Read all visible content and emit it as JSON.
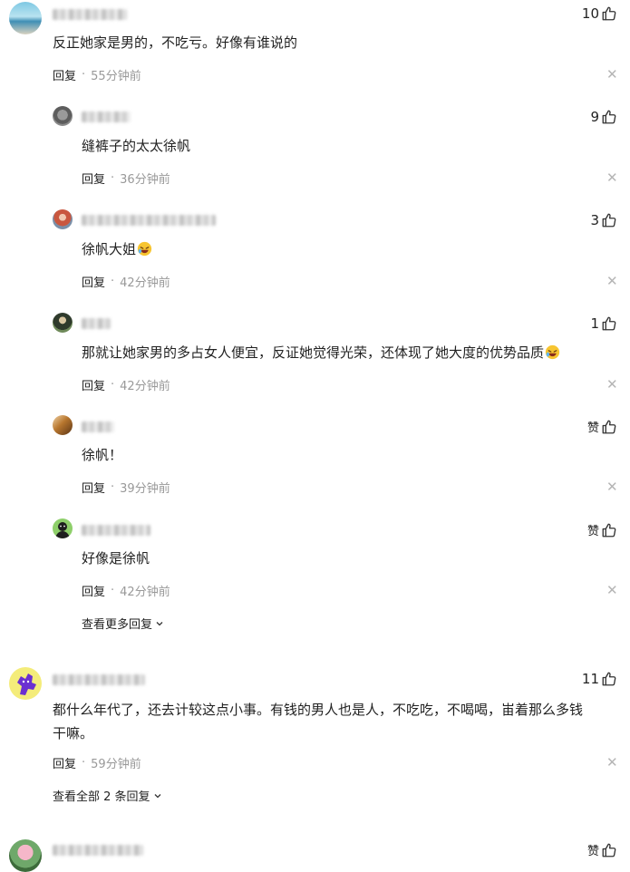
{
  "comments": [
    {
      "likes": "10",
      "text": "反正她家是男的，不吃亏。好像有谁说的",
      "reply_label": "回复",
      "time": "55分钟前",
      "replies": [
        {
          "likes": "9",
          "text": "缝裤子的太太徐帆",
          "reply_label": "回复",
          "time": "36分钟前"
        },
        {
          "likes": "3",
          "text": "徐帆大姐",
          "emoji": "laughing-emoji",
          "reply_label": "回复",
          "time": "42分钟前"
        },
        {
          "likes": "1",
          "text": "那就让她家男的多占女人便宜，反证她觉得光荣，还体现了她大度的优势品质",
          "emoji": "laughing-emoji",
          "reply_label": "回复",
          "time": "42分钟前"
        },
        {
          "likes": "赞",
          "text": "徐帆！",
          "reply_label": "回复",
          "time": "39分钟前"
        },
        {
          "likes": "赞",
          "text": "好像是徐帆",
          "reply_label": "回复",
          "time": "42分钟前"
        }
      ],
      "more_replies": "查看更多回复"
    },
    {
      "likes": "11",
      "text_line1": "都什么年代了，还去计较这点小事。有钱的男人也是人，不吃吃，不喝喝，峀着那么多钱",
      "text_line2": "干嘛。",
      "reply_label": "回复",
      "time": "59分钟前",
      "more_replies": "查看全部 2 条回复"
    },
    {
      "likes": "赞"
    }
  ],
  "separator": "·",
  "colors": {
    "text": "#222222",
    "muted": "#999999",
    "close": "#b5b5b5"
  }
}
